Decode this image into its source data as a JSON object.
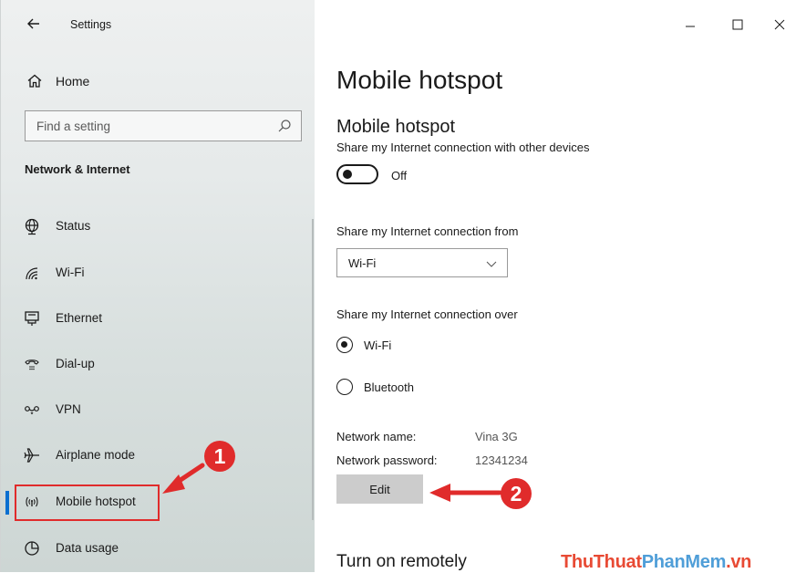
{
  "window": {
    "app_title": "Settings",
    "controls": {
      "minimize": "–",
      "maximize": "☐",
      "close": "✕"
    }
  },
  "sidebar": {
    "home_label": "Home",
    "search_placeholder": "Find a setting",
    "section_title": "Network & Internet",
    "items": [
      {
        "label": "Status",
        "icon": "globe-icon"
      },
      {
        "label": "Wi-Fi",
        "icon": "wifi-icon"
      },
      {
        "label": "Ethernet",
        "icon": "ethernet-icon"
      },
      {
        "label": "Dial-up",
        "icon": "dialup-icon"
      },
      {
        "label": "VPN",
        "icon": "vpn-icon"
      },
      {
        "label": "Airplane mode",
        "icon": "airplane-icon"
      },
      {
        "label": "Mobile hotspot",
        "icon": "hotspot-icon",
        "active": true
      },
      {
        "label": "Data usage",
        "icon": "data-usage-icon"
      }
    ]
  },
  "main": {
    "page_title": "Mobile hotspot",
    "section_title": "Mobile hotspot",
    "share_desc": "Share my Internet connection with other devices",
    "toggle_state": "Off",
    "share_from_label": "Share my Internet connection from",
    "share_from_value": "Wi-Fi",
    "share_over_label": "Share my Internet connection over",
    "share_over_options": [
      {
        "label": "Wi-Fi",
        "selected": true
      },
      {
        "label": "Bluetooth",
        "selected": false
      }
    ],
    "network_name_label": "Network name:",
    "network_name_value": "Vina 3G",
    "network_password_label": "Network password:",
    "network_password_value": "12341234",
    "edit_label": "Edit",
    "turn_on_remotely": "Turn on remotely"
  },
  "annotations": {
    "callout_1": "1",
    "callout_2": "2"
  },
  "watermark": {
    "part1": "ThuThuat",
    "part2": "PhanMem",
    "part3": ".vn"
  },
  "colors": {
    "accent": "#0a6fd0",
    "annotation_red": "#e02b2b",
    "watermark_red": "#e84a34",
    "watermark_blue": "#4f9ed8"
  }
}
